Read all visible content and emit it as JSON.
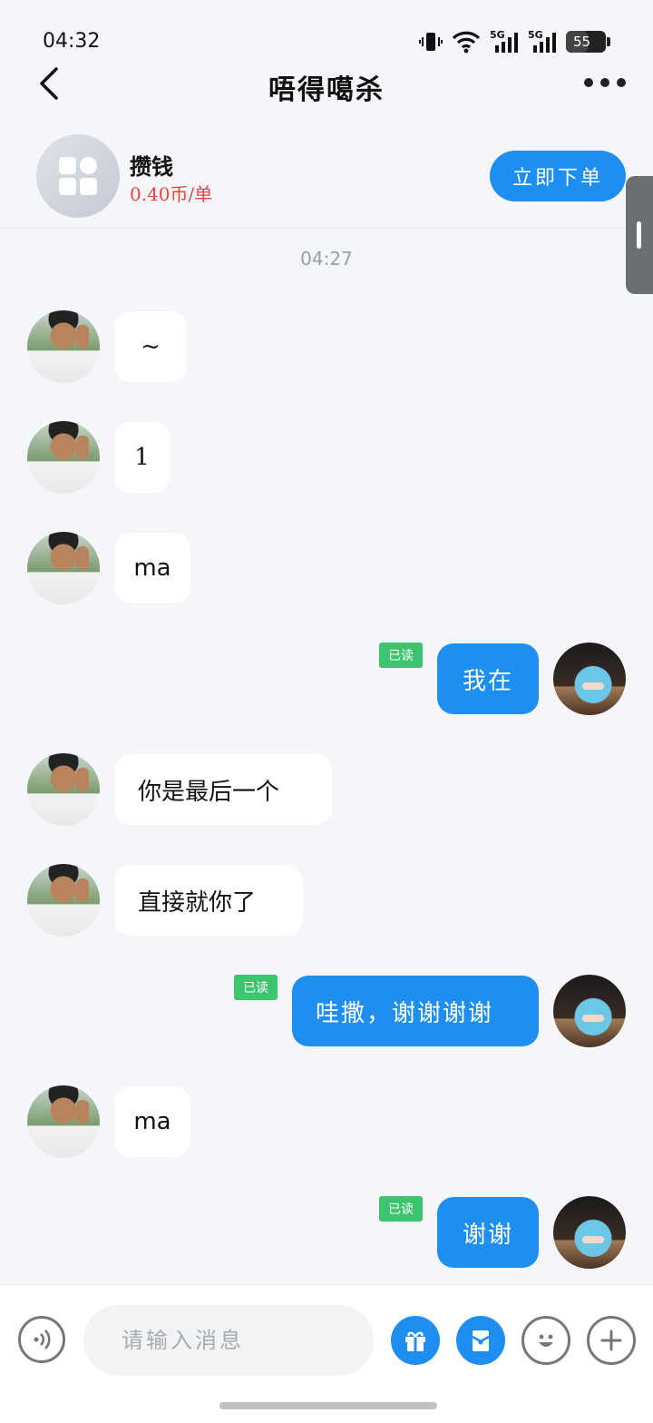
{
  "status": {
    "time": "04:32",
    "battery": "55",
    "network_1": "5G",
    "network_2": "5G"
  },
  "nav": {
    "title": "唔得噶杀"
  },
  "product": {
    "name": "攒钱",
    "price": "0.40币/单",
    "order_label": "立即下单"
  },
  "chat": {
    "timestamp": "04:27",
    "read_label": "已读",
    "messages": [
      {
        "side": "in",
        "text": "~"
      },
      {
        "side": "in",
        "text": "1"
      },
      {
        "side": "in",
        "text": "ma"
      },
      {
        "side": "out",
        "text": "我在",
        "read": true
      },
      {
        "side": "in",
        "text": "你是最后一个"
      },
      {
        "side": "in",
        "text": "直接就你了"
      },
      {
        "side": "out",
        "text": "哇撒，谢谢谢谢",
        "read": true
      },
      {
        "side": "in",
        "text": "ma"
      },
      {
        "side": "out",
        "text": "谢谢",
        "read": true
      }
    ]
  },
  "input": {
    "placeholder": "请输入消息"
  },
  "colors": {
    "accent": "#1e8ff0",
    "read_badge": "#3dc46e",
    "price": "#e8453c"
  }
}
